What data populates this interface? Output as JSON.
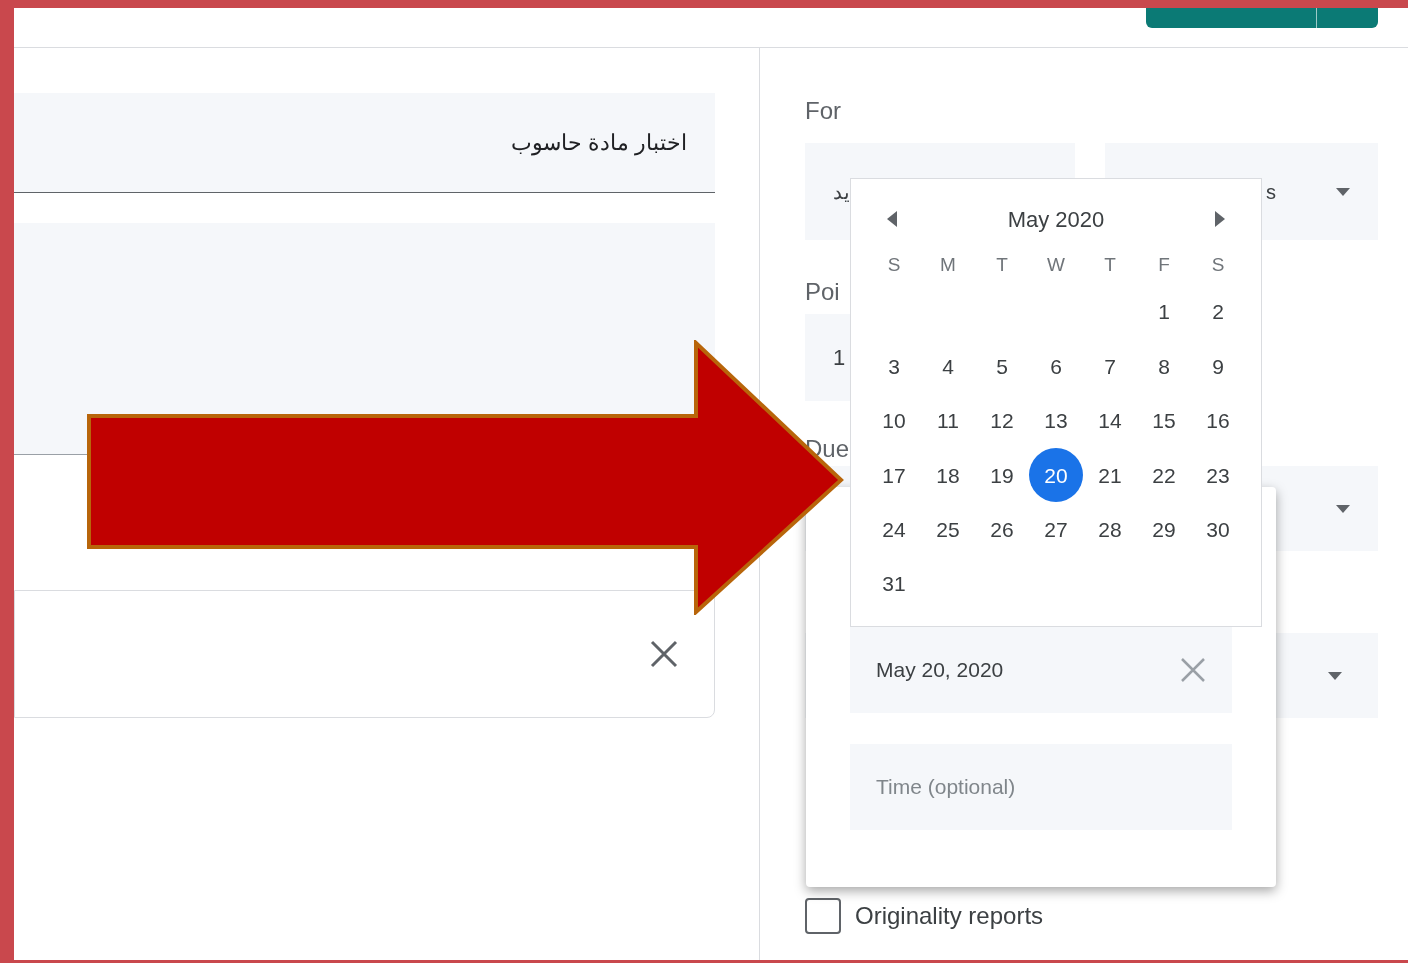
{
  "title_field": {
    "value": "اختبار مادة حاسوب"
  },
  "for_section": {
    "label": "For",
    "class_select": {
      "value": "يد"
    },
    "students_select": {
      "value": "s"
    }
  },
  "points_section": {
    "label": "Poi",
    "value": "1"
  },
  "due_section": {
    "label": "Due"
  },
  "due_popover": {
    "date_value": "May 20, 2020",
    "time_placeholder": "Time (optional)"
  },
  "calendar": {
    "month": "May 2020",
    "weekdays": [
      "S",
      "M",
      "T",
      "W",
      "T",
      "F",
      "S"
    ],
    "weeks": [
      [
        {
          "label": "1",
          "selected": false
        },
        {
          "label": "2",
          "selected": false
        }
      ],
      [
        {
          "label": "3",
          "selected": false
        },
        {
          "label": "4",
          "selected": false
        },
        {
          "label": "5",
          "selected": false
        },
        {
          "label": "6",
          "selected": false
        },
        {
          "label": "7",
          "selected": false
        },
        {
          "label": "8",
          "selected": false
        },
        {
          "label": "9",
          "selected": false
        }
      ],
      [
        {
          "label": "10",
          "selected": false
        },
        {
          "label": "11",
          "selected": false
        },
        {
          "label": "12",
          "selected": false
        },
        {
          "label": "13",
          "selected": false
        },
        {
          "label": "14",
          "selected": false
        },
        {
          "label": "15",
          "selected": false
        },
        {
          "label": "16",
          "selected": false
        }
      ],
      [
        {
          "label": "17",
          "selected": false
        },
        {
          "label": "18",
          "selected": false
        },
        {
          "label": "19",
          "selected": false
        },
        {
          "label": "20",
          "selected": true
        },
        {
          "label": "21",
          "selected": false
        },
        {
          "label": "22",
          "selected": false
        },
        {
          "label": "23",
          "selected": false
        }
      ],
      [
        {
          "label": "24",
          "selected": false
        },
        {
          "label": "25",
          "selected": false
        },
        {
          "label": "26",
          "selected": false
        },
        {
          "label": "27",
          "selected": false
        },
        {
          "label": "28",
          "selected": false
        },
        {
          "label": "29",
          "selected": false
        },
        {
          "label": "30",
          "selected": false
        }
      ],
      [
        {
          "label": "31",
          "selected": false
        }
      ]
    ]
  },
  "originality": {
    "label": "Originality reports",
    "checked": false
  }
}
